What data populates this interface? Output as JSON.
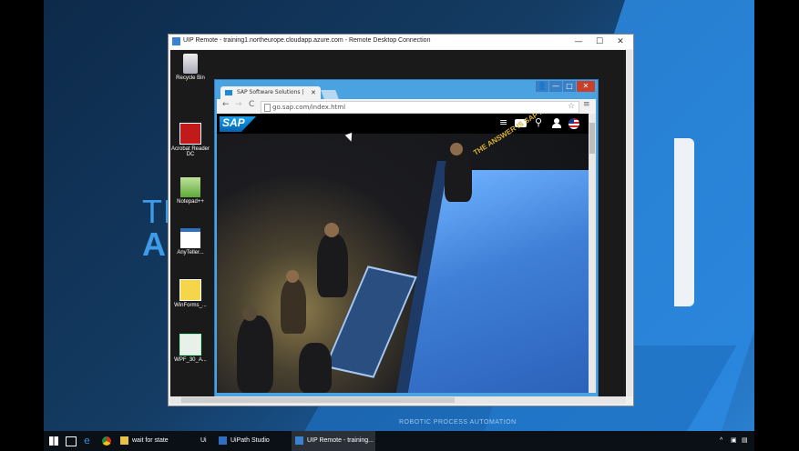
{
  "background": {
    "text_th": "TH",
    "text_al": "Al",
    "bottom_text": "ROBOTIC PROCESS AUTOMATION"
  },
  "rdp_window": {
    "title": "UIP Remote - training1.northeurope.cloudapp.azure.com - Remote Desktop Connection",
    "minimize": "—",
    "maximize": "☐",
    "close": "✕"
  },
  "desktop_icons": [
    {
      "label": "Recycle Bin",
      "icon": "recycle-bin-icon"
    },
    {
      "label": "Acrobat Reader DC",
      "icon": "acrobat-icon"
    },
    {
      "label": "Notepad++",
      "icon": "notepad-icon"
    },
    {
      "label": "AnyTeller...",
      "icon": "window-app-icon"
    },
    {
      "label": "WinForms_...",
      "icon": "winforms-icon"
    },
    {
      "label": "WPF_30_A...",
      "icon": "wpf-icon"
    }
  ],
  "browser": {
    "tab_title": "SAP Software Solutions | ",
    "tab_close": "✕",
    "url": "go.sap.com/index.html",
    "back": "←",
    "forward": "→",
    "reload": "C",
    "star": "☆",
    "menu": "≡",
    "win_user": "👤",
    "win_min": "—",
    "win_max": "□",
    "win_close": "✕"
  },
  "sap_page": {
    "logo": "SAP",
    "slogan": "THE ANSWER IS SAP HA",
    "icons": [
      "menu-icon",
      "chat-icon",
      "search-icon",
      "user-icon",
      "flag-us-icon"
    ]
  },
  "taskbar": {
    "items": [
      {
        "label": "wait for state",
        "color": "#e8c14a"
      },
      {
        "label": "Ui",
        "color": "#2f6fc2"
      },
      {
        "label": "UiPath Studio",
        "color": "#2f6fc2"
      },
      {
        "label": "UIP Remote - training...",
        "color": "#3a82d0"
      }
    ],
    "tray": [
      "^",
      "▣",
      "▤"
    ]
  }
}
